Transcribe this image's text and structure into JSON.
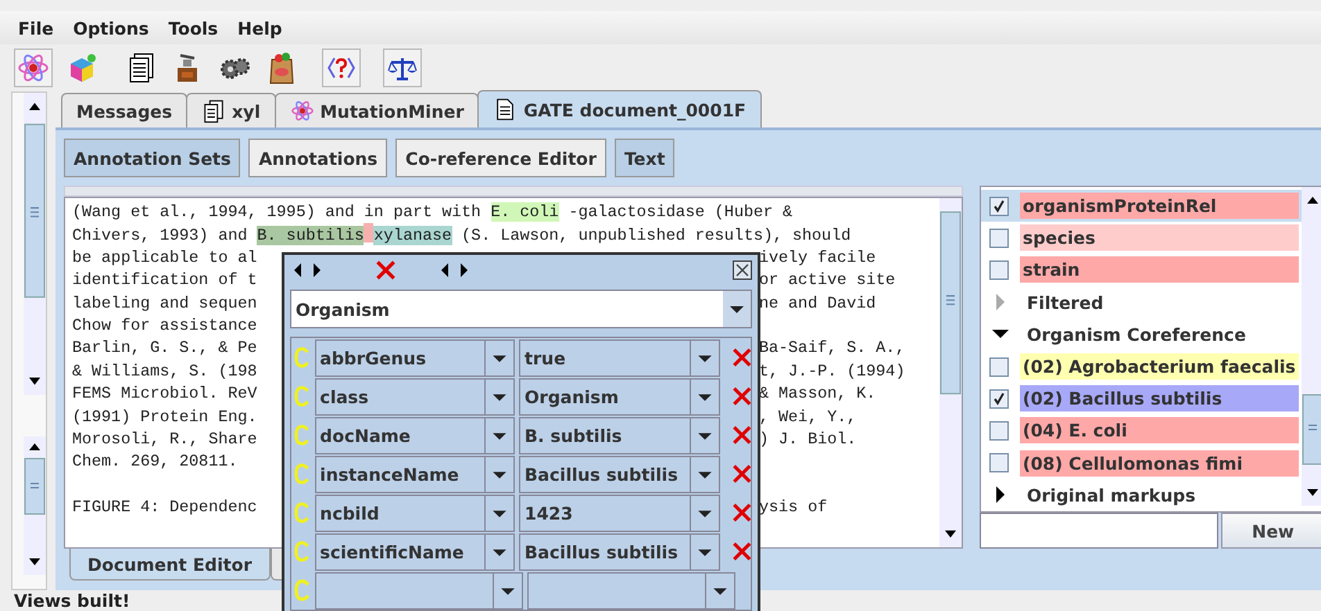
{
  "menu": [
    "File",
    "Options",
    "Tools",
    "Help"
  ],
  "tabs": [
    {
      "label": "Messages",
      "kind": "plain",
      "selected": false
    },
    {
      "label": "xyl",
      "kind": "documents",
      "selected": false
    },
    {
      "label": "MutationMiner",
      "kind": "atom",
      "selected": false
    },
    {
      "label": "GATE document_0001F",
      "kind": "document",
      "selected": true
    }
  ],
  "view_buttons": [
    {
      "label": "Annotation Sets",
      "selected": true
    },
    {
      "label": "Annotations",
      "selected": false
    },
    {
      "label": "Co-reference Editor",
      "selected": false
    },
    {
      "label": "Text",
      "selected": true
    }
  ],
  "text_lines": [
    {
      "segments": [
        {
          "text": "(Wang et al., 1994, 1995) and in part with "
        },
        {
          "text": "E. coli",
          "color": "#d0f7b8"
        },
        {
          "text": " -galactosidase (Huber &"
        }
      ]
    },
    {
      "segments": [
        {
          "text": "Chivers, 1993) and "
        },
        {
          "text": "B. subtilis",
          "color": "#a9c7a0"
        },
        {
          "kind": "gap",
          "color": "#f7b0b0"
        },
        {
          "text": "xylanase",
          "color": "#a9d6d0"
        },
        {
          "text": " (S. Lawson, unpublished results), should"
        }
      ]
    },
    {
      "segments": [
        {
          "text": "be applicable to al"
        }
      ],
      "right": "ively facile"
    },
    {
      "segments": [
        {
          "text": "identification of t"
        }
      ],
      "right": "or active site"
    },
    {
      "segments": [
        {
          "text": "labeling and sequen"
        }
      ],
      "right": "ne and David"
    },
    {
      "segments": [
        {
          "text": "Chow for assistance"
        }
      ]
    },
    {
      "segments": [
        {
          "text": "Barlin, G. S., & Pe"
        }
      ],
      "right": "Ba-Saif, S. A.,"
    },
    {
      "segments": [
        {
          "text": "& Williams, S. (198"
        }
      ],
      "right": "t, J.-P. (1994)"
    },
    {
      "segments": [
        {
          "text": "FEMS Microbiol. ReV"
        }
      ],
      "right": "& Masson, K."
    },
    {
      "segments": [
        {
          "text": "(1991) Protein Eng."
        }
      ],
      "right": ", Wei, Y.,"
    },
    {
      "segments": [
        {
          "text": "Morosoli, R., Share"
        }
      ],
      "right": ") J. Biol."
    },
    {
      "segments": [
        {
          "text": "Chem. 269, 20811."
        }
      ]
    },
    {
      "segments": [
        {
          "text": "FIGURE 4: Dependenc"
        }
      ],
      "right": "ysis of",
      "gap_before": true
    }
  ],
  "editor_tabs": [
    {
      "label": "Document Editor",
      "selected": true
    },
    {
      "selected": false
    }
  ],
  "annotation_list": [
    {
      "kind": "annotation",
      "label": "organismProteinRel",
      "checked": true,
      "selected": true,
      "color": "#ffa8a8"
    },
    {
      "kind": "annotation",
      "label": "species",
      "checked": false,
      "selected": false,
      "color": "#ffcccc"
    },
    {
      "kind": "annotation",
      "label": "strain",
      "checked": false,
      "selected": false,
      "color": "#ffa8a8"
    },
    {
      "kind": "group",
      "label": "Filtered",
      "expanded": false,
      "disabled": true
    },
    {
      "kind": "group",
      "label": "Organism Coreference",
      "expanded": true,
      "disabled": false
    },
    {
      "kind": "annotation",
      "label": "(02) Agrobacterium faecalis",
      "checked": false,
      "selected": false,
      "color": "#ffffb0"
    },
    {
      "kind": "annotation",
      "label": "(02) Bacillus subtilis",
      "checked": true,
      "selected": false,
      "color": "#a8a8f8"
    },
    {
      "kind": "annotation",
      "label": "(04) E. coli",
      "checked": false,
      "selected": false,
      "color": "#ffa8a8"
    },
    {
      "kind": "annotation",
      "label": "(08) Cellulomonas fimi",
      "checked": false,
      "selected": false,
      "color": "#ffa8a8"
    },
    {
      "kind": "group",
      "label": "Original markups",
      "expanded": false,
      "disabled": false
    }
  ],
  "new_set_button": "New",
  "popup": {
    "type": "Organism",
    "features": [
      {
        "kind": "feature",
        "name": "abbrGenus",
        "value": "true"
      },
      {
        "kind": "feature",
        "name": "class",
        "value": "Organism"
      },
      {
        "kind": "feature",
        "name": "docName",
        "value": "B. subtilis"
      },
      {
        "kind": "feature",
        "name": "instanceName",
        "value": "Bacillus subtilis"
      },
      {
        "kind": "feature",
        "name": "ncbild",
        "value": "1423"
      },
      {
        "kind": "feature",
        "name": "scientificName",
        "value": "Bacillus subtilis"
      },
      {
        "kind": "blank"
      }
    ]
  },
  "status_bar": "Views built!"
}
